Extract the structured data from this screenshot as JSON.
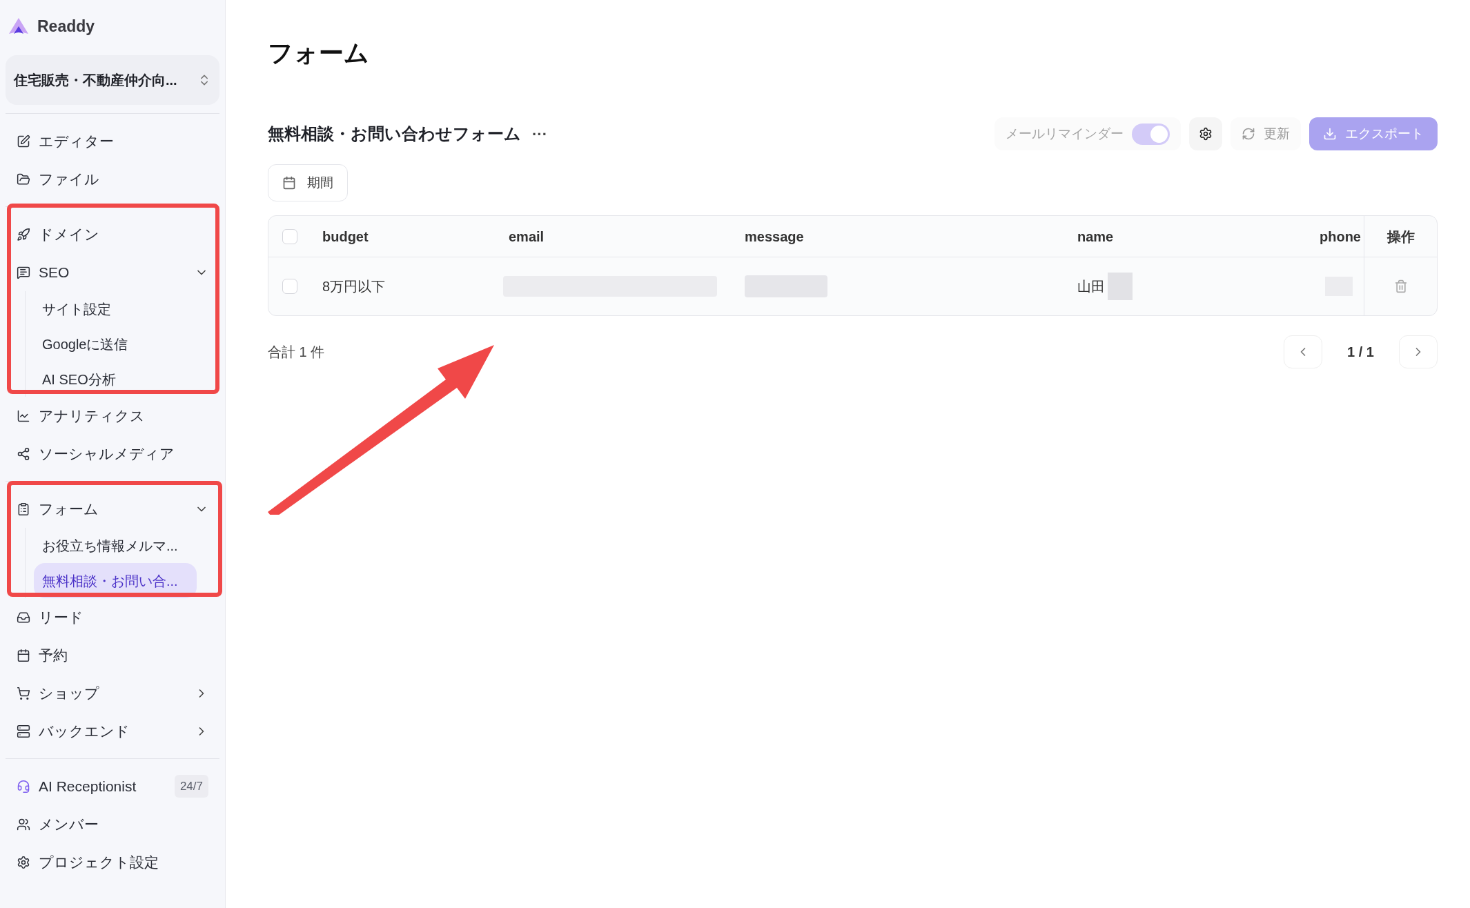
{
  "sidebar": {
    "logo": "Readdy",
    "project": "住宅販売・不動産仲介向...",
    "groups": [
      [
        {
          "label": "エディター",
          "selected": false
        },
        {
          "label": "ファイル",
          "selected": false
        }
      ],
      [
        {
          "label": "ドメイン",
          "selected": false
        },
        {
          "label": "SEO",
          "selected": false,
          "expanded": true,
          "children": [
            {
              "label": "サイト設定",
              "selected": false
            },
            {
              "label": "Googleに送信",
              "selected": false
            },
            {
              "label": "AI SEO分析",
              "selected": false
            }
          ]
        },
        {
          "label": "アナリティクス",
          "selected": false
        },
        {
          "label": "ソーシャルメディア",
          "selected": false
        }
      ],
      [
        {
          "label": "フォーム",
          "selected": false,
          "expanded": true,
          "children": [
            {
              "label": "お役立ち情報メルマ...",
              "selected": false
            },
            {
              "label": "無料相談・お問い合...",
              "selected": true
            }
          ]
        },
        {
          "label": "リード",
          "selected": false
        },
        {
          "label": "予約",
          "selected": false
        },
        {
          "label": "ショップ",
          "selected": false,
          "expanded": false
        },
        {
          "label": "バックエンド",
          "selected": false,
          "expanded": false
        }
      ],
      [
        {
          "label": "AI Receptionist",
          "badge": "24/7",
          "selected": false
        },
        {
          "label": "メンバー",
          "selected": false
        },
        {
          "label": "プロジェクト設定",
          "selected": false
        }
      ]
    ]
  },
  "page_title": "フォーム",
  "form": {
    "title": "無料相談・お問い合わせフォーム",
    "more": "···",
    "reminder": {
      "label": "メールリマインダー",
      "on": true
    },
    "refresh": {
      "label": "更新",
      "disabled": true
    },
    "export": {
      "label": "エクスポート",
      "disabled": true
    },
    "period": "期間"
  },
  "table": {
    "select_all": false,
    "columns": [
      "budget",
      "email",
      "message",
      "name",
      "phone",
      "操作"
    ],
    "rows": [
      {
        "checked": false,
        "budget": "8万円以下",
        "name": "山田"
      }
    ]
  },
  "total": "合計 1 件",
  "pagination": "1 / 1"
}
